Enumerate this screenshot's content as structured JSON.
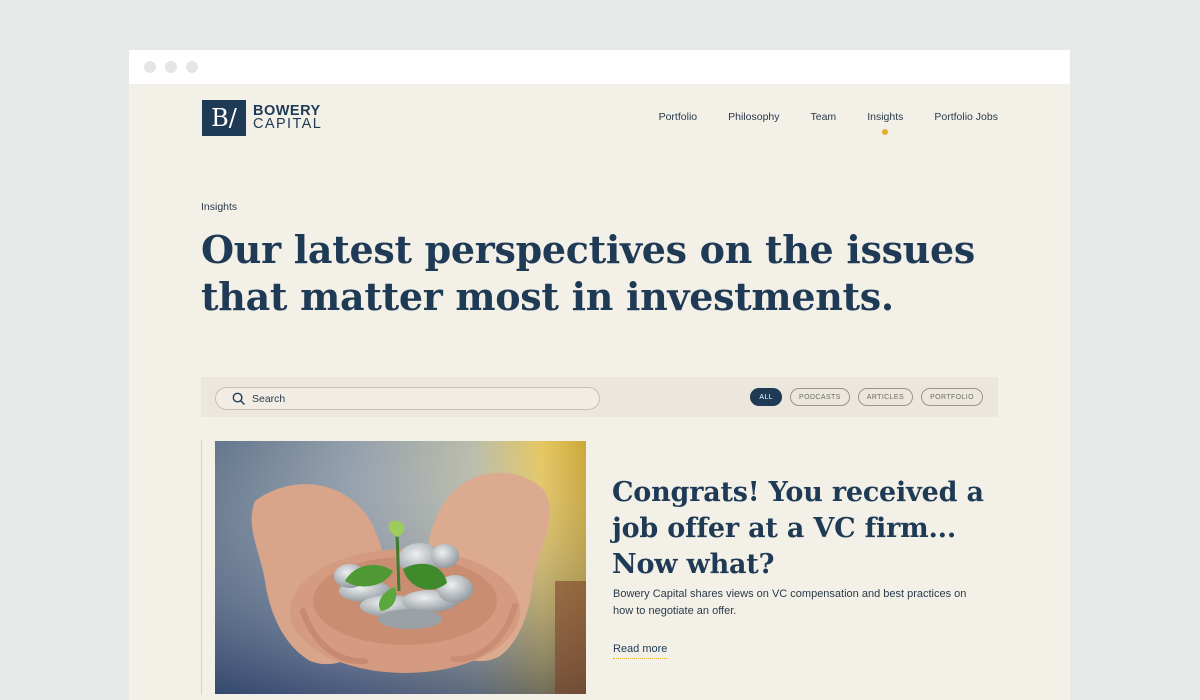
{
  "brand": {
    "mark": "B/",
    "line1": "BOWERY",
    "line2": "CAPITAL"
  },
  "nav": {
    "items": [
      {
        "label": "Portfolio",
        "active": false
      },
      {
        "label": "Philosophy",
        "active": false
      },
      {
        "label": "Team",
        "active": false
      },
      {
        "label": "Insights",
        "active": true
      },
      {
        "label": "Portfolio Jobs",
        "active": false
      }
    ]
  },
  "hero": {
    "eyebrow": "Insights",
    "headline": "Our latest perspectives on the issues that matter most in investments."
  },
  "filters": {
    "search_placeholder": "Search",
    "pills": [
      {
        "label": "ALL",
        "active": true
      },
      {
        "label": "PODCASTS",
        "active": false
      },
      {
        "label": "ARTICLES",
        "active": false
      },
      {
        "label": "PORTFOLIO",
        "active": false
      }
    ]
  },
  "featured": {
    "image_subject": "hands-holding-coins-with-plant-sprout",
    "title": "Congrats! You received a job offer at a VC firm... Now what?",
    "description": "Bowery Capital shares views on VC compensation and best practices on how to negotiate an offer.",
    "cta": "Read more"
  },
  "colors": {
    "navy": "#1f3a55",
    "accent": "#e0b12a",
    "page_bg": "#f3f0e8"
  }
}
